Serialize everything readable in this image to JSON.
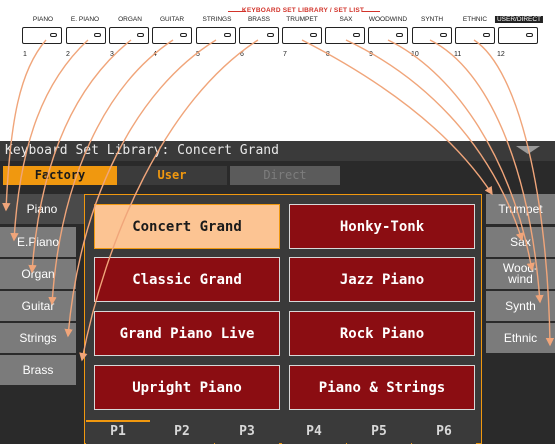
{
  "panel": {
    "section_title": "KEYBOARD SET LIBRARY / SET LIST",
    "labels": [
      "PIANO",
      "E. PIANO",
      "ORGAN",
      "GUITAR",
      "STRINGS",
      "BRASS",
      "TRUMPET",
      "SAX",
      "WOODWIND",
      "SYNTH",
      "ETHNIC",
      "USER/DIRECT"
    ],
    "numbers": [
      "1",
      "2",
      "3",
      "4",
      "5",
      "6",
      "7",
      "8",
      "9",
      "10",
      "11",
      "12"
    ]
  },
  "display": {
    "title": "Keyboard Set Library: Concert Grand",
    "tabs": {
      "factory": "Factory",
      "user": "User",
      "direct": "Direct"
    },
    "left_categories": [
      "Piano",
      "E.Piano",
      "Organ",
      "Guitar",
      "Strings",
      "Brass"
    ],
    "right_categories": [
      "Trumpet",
      "Sax",
      "Wood-\nwind",
      "Synth",
      "Ethnic"
    ],
    "sounds": [
      "Concert Grand",
      "Honky-Tonk",
      "Classic Grand",
      "Jazz Piano",
      "Grand Piano Live",
      "Rock Piano",
      "Upright Piano",
      "Piano & Strings"
    ],
    "pages": [
      "P1",
      "P2",
      "P3",
      "P4",
      "P5",
      "P6"
    ],
    "selected_sound": "Concert Grand",
    "selected_page": "P1",
    "selected_category": "Piano"
  },
  "colors": {
    "accent": "#f0980f",
    "sound_button": "#8b0d12",
    "selected_sound": "#fcc493",
    "callout": "#f0a57a"
  }
}
